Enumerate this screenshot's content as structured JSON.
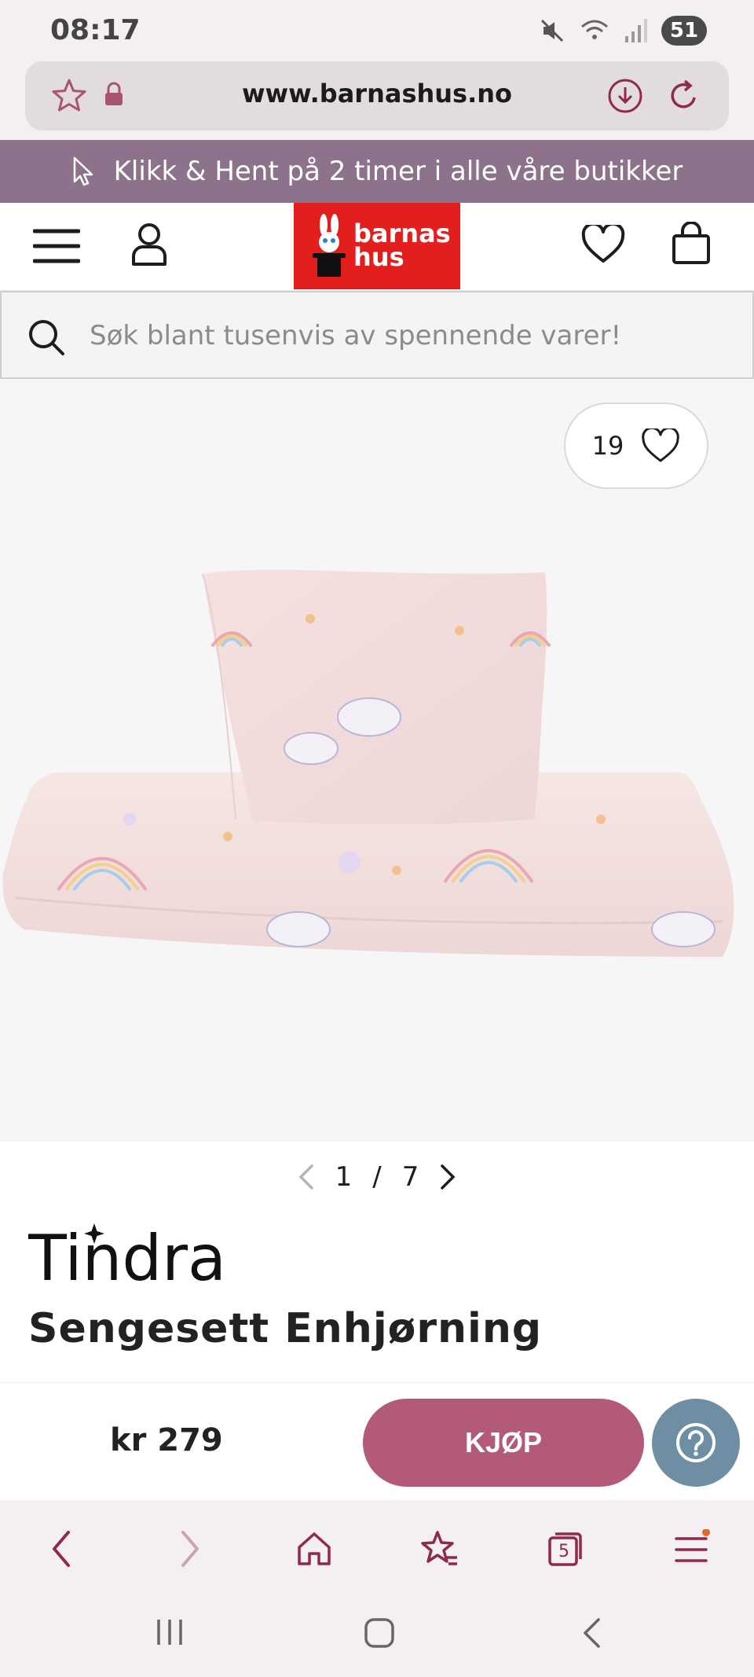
{
  "status_bar": {
    "time": "08:17",
    "battery": "51"
  },
  "browser": {
    "url": "www.barnashus.no",
    "tab_count": "5"
  },
  "promo": {
    "text": "Klikk & Hent på 2 timer i alle våre butikker"
  },
  "header": {
    "logo_line1": "barnas",
    "logo_line2": "hus"
  },
  "search": {
    "placeholder": "Søk blant tusenvis av spennende varer!"
  },
  "product": {
    "wishlist_count": "19",
    "image_index": "1",
    "image_separator": "/",
    "image_total": "7",
    "brand": "Tindra",
    "title": "Sengesett Enhjørning",
    "price": "kr 279",
    "buy_label": "KJØP"
  },
  "colors": {
    "promo_bg": "#8d728b",
    "logo_red": "#e31e1e",
    "buy_button": "#b35a7a",
    "help_button": "#6e8fa3",
    "browser_accent": "#8f2a49"
  }
}
